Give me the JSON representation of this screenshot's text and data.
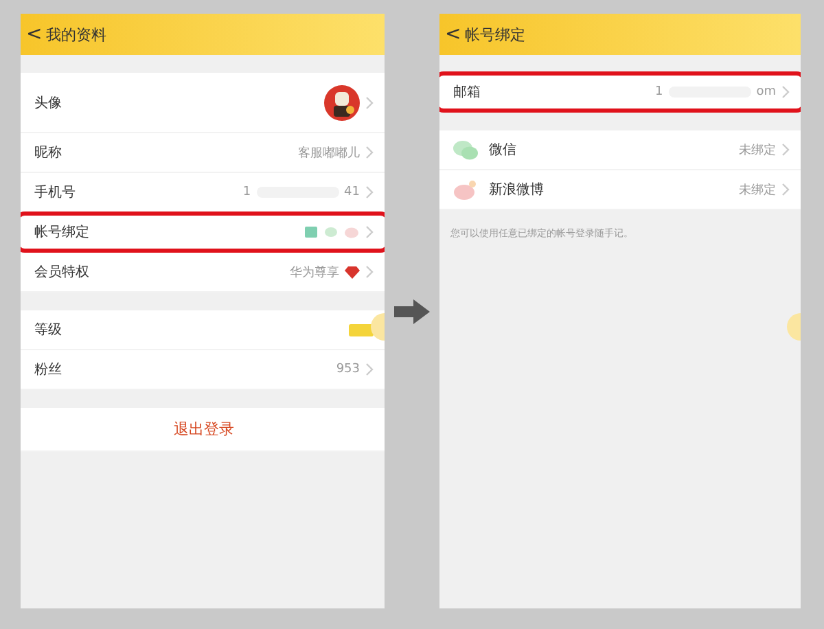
{
  "screens": [
    {
      "title": "我的资料",
      "back": "<",
      "groups": [
        [
          {
            "kind": "avatar",
            "label": "头像",
            "highlighted": false
          },
          {
            "kind": "text",
            "label": "昵称",
            "value": "客服嘟嘟儿",
            "highlighted": false
          },
          {
            "kind": "masked",
            "label": "手机号",
            "parts": [
              "1",
              "41"
            ],
            "highlighted": false
          },
          {
            "kind": "bindings",
            "label": "帐号绑定",
            "highlighted": true
          },
          {
            "kind": "vip",
            "label": "会员特权",
            "value": "华为尊享",
            "highlighted": false
          }
        ],
        [
          {
            "kind": "level",
            "label": "等级",
            "highlighted": false
          },
          {
            "kind": "text",
            "label": "粉丝",
            "value": "953",
            "highlighted": false
          }
        ],
        [
          {
            "kind": "logout",
            "label": "退出登录",
            "highlighted": false
          }
        ]
      ]
    },
    {
      "title": "帐号绑定",
      "back": "<",
      "groups": [
        [
          {
            "kind": "masked",
            "label": "邮箱",
            "parts": [
              "1",
              "om"
            ],
            "highlighted": true
          }
        ],
        [
          {
            "kind": "wechat",
            "label": "微信",
            "value": "未绑定",
            "highlighted": false
          },
          {
            "kind": "weibo",
            "label": "新浪微博",
            "value": "未绑定",
            "highlighted": false
          }
        ]
      ],
      "note": "您可以使用任意已绑定的帐号登录随手记。"
    }
  ]
}
